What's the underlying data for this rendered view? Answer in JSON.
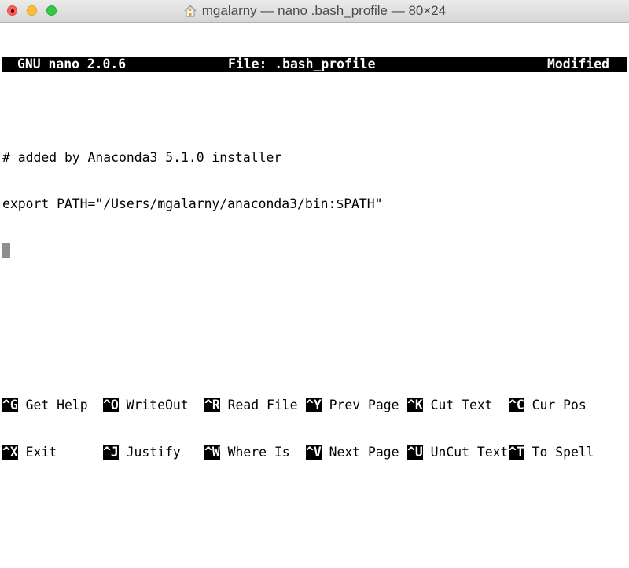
{
  "window": {
    "title": "mgalarny — nano .bash_profile — 80×24",
    "title_icon": "home-icon",
    "traffic_lights": {
      "close": "#fc605c",
      "minimize": "#fdbc40",
      "maximize": "#34c84a"
    }
  },
  "nano": {
    "status_bar": {
      "version": "GNU nano 2.0.6",
      "file": "File: .bash_profile",
      "state": "Modified"
    },
    "lines": [
      "",
      "# added by Anaconda3 5.1.0 installer",
      "export PATH=\"/Users/mgalarny/anaconda3/bin:$PATH\""
    ],
    "cursor_line": 4,
    "shortcuts": [
      [
        {
          "key": "^G",
          "label": "Get Help"
        },
        {
          "key": "^O",
          "label": "WriteOut"
        },
        {
          "key": "^R",
          "label": "Read File"
        },
        {
          "key": "^Y",
          "label": "Prev Page"
        },
        {
          "key": "^K",
          "label": "Cut Text"
        },
        {
          "key": "^C",
          "label": "Cur Pos"
        }
      ],
      [
        {
          "key": "^X",
          "label": "Exit"
        },
        {
          "key": "^J",
          "label": "Justify"
        },
        {
          "key": "^W",
          "label": "Where Is"
        },
        {
          "key": "^V",
          "label": "Next Page"
        },
        {
          "key": "^U",
          "label": "UnCut Text"
        },
        {
          "key": "^T",
          "label": "To Spell"
        }
      ]
    ]
  }
}
